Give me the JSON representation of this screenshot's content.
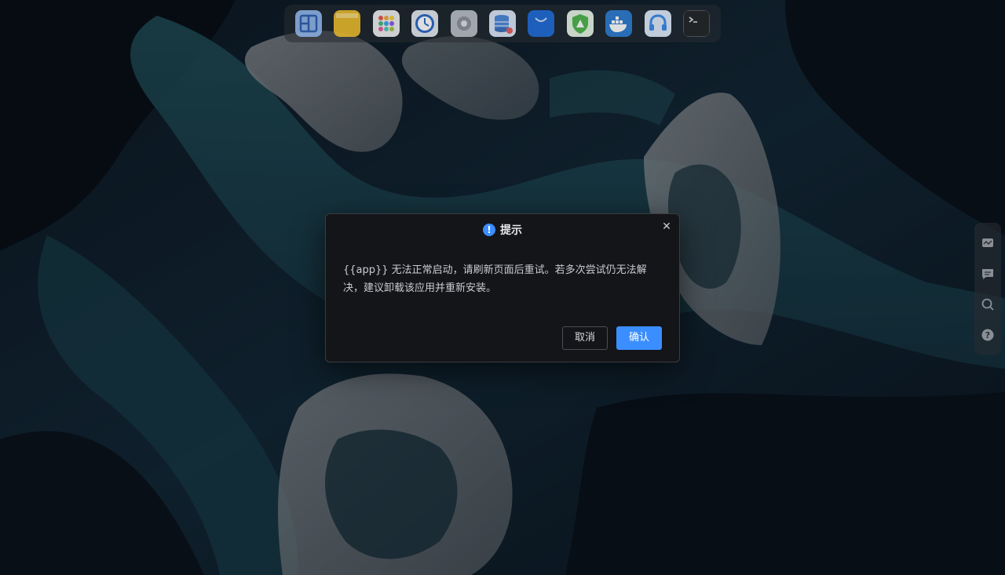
{
  "dock": {
    "apps": [
      {
        "name": "file-manager-icon",
        "color": "#4a78c8"
      },
      {
        "name": "notes-icon",
        "color": "#e8b92a"
      },
      {
        "name": "app-center-icon",
        "color": "#e8e8e8"
      },
      {
        "name": "clock-icon",
        "color": "#2c68c4"
      },
      {
        "name": "settings-icon",
        "color": "#8b9099"
      },
      {
        "name": "database-icon",
        "color": "#6aa0e8"
      },
      {
        "name": "store-icon",
        "color": "#1e6ad4"
      },
      {
        "name": "security-icon",
        "color": "#4fb54a"
      },
      {
        "name": "docker-icon",
        "color": "#2c7ad0"
      },
      {
        "name": "support-icon",
        "color": "#3a8aea"
      },
      {
        "name": "terminal-icon",
        "color": "#222426"
      }
    ]
  },
  "side_toolbar": {
    "items": [
      "monitor-icon",
      "chat-icon",
      "search-icon",
      "help-icon"
    ]
  },
  "dialog": {
    "title": "提示",
    "message": "{{app}} 无法正常启动，请刷新页面后重试。若多次尝试仍无法解决，建议卸载该应用并重新安装。",
    "cancel_label": "取消",
    "confirm_label": "确认",
    "close_glyph": "✕",
    "warn_glyph": "!"
  },
  "colors": {
    "accent": "#3b8eff",
    "dialog_bg": "#141518"
  }
}
